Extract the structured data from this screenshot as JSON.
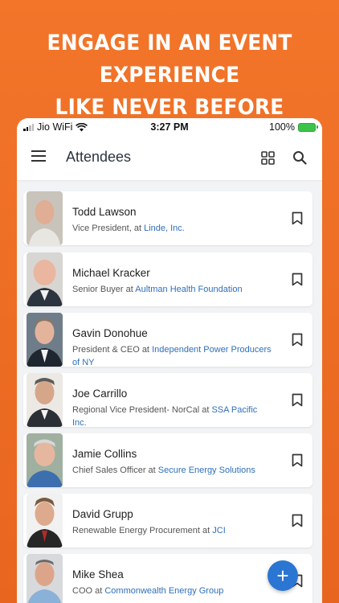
{
  "promo": {
    "line1": "ENGAGE IN AN EVENT EXPERIENCE",
    "line2": "LIKE NEVER BEFORE"
  },
  "status_bar": {
    "carrier": "Jio WiFi",
    "time": "3:27 PM",
    "battery": "100%"
  },
  "app_bar": {
    "title": "Attendees",
    "icons": [
      "menu-icon",
      "grid-icon",
      "search-icon"
    ]
  },
  "attendees": [
    {
      "name": "Todd Lawson",
      "role": "Vice President, at",
      "org": "Linde, Inc."
    },
    {
      "name": "Michael Kracker",
      "role": "Senior Buyer at",
      "org": "Aultman Health Foundation"
    },
    {
      "name": "Gavin Donohue",
      "role": "President & CEO at",
      "org": "Independent Power Producers of NY"
    },
    {
      "name": "Joe Carrillo",
      "role": "Regional Vice President- NorCal at",
      "org": "SSA Pacific Inc."
    },
    {
      "name": "Jamie Collins",
      "role": "Chief Sales Officer at",
      "org": "Secure Energy Solutions"
    },
    {
      "name": "David Grupp",
      "role": "Renewable Energy Procurement at",
      "org": "JCI"
    },
    {
      "name": "Mike Shea",
      "role": "COO at",
      "org": "Commonwealth Energy Group"
    }
  ],
  "fab": {
    "label": "+",
    "icon": "plus-icon"
  },
  "colors": {
    "accent": "#2a76d2",
    "brand_orange": "#f2752a",
    "link": "#2f6fba"
  }
}
